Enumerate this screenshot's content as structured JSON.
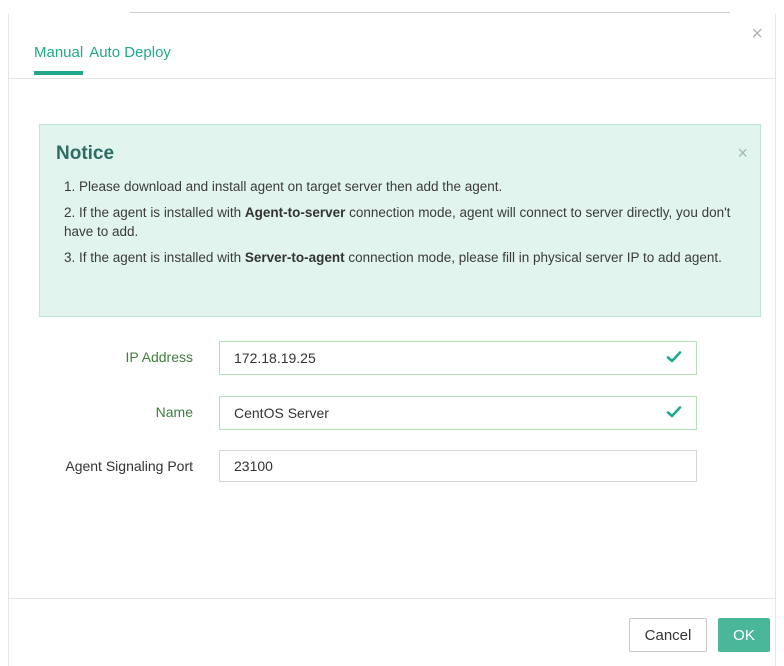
{
  "dialog": {
    "close_icon": "close-icon"
  },
  "tabs": [
    {
      "label": "Manual",
      "active": true
    },
    {
      "label": "Auto Deploy",
      "active": false
    }
  ],
  "notice": {
    "title": "Notice",
    "close_icon": "close-icon",
    "items": [
      {
        "parts": [
          "1. Please download and install agent on target server then add the agent."
        ]
      },
      {
        "pre": "2. If the agent is installed with ",
        "bold": "Agent-to-server",
        "post": " connection mode, agent will connect to server directly, you don't have to add."
      },
      {
        "pre": "3. If the agent is installed with ",
        "bold": "Server-to-agent",
        "post": " connection mode, please fill in physical server IP to add agent."
      }
    ]
  },
  "form": {
    "ip_address": {
      "label": "IP Address",
      "value": "172.18.19.25",
      "valid": true
    },
    "name": {
      "label": "Name",
      "value": "CentOS Server",
      "valid": true
    },
    "signaling_port": {
      "label": "Agent Signaling Port",
      "value": "23100"
    }
  },
  "buttons": {
    "cancel": "Cancel",
    "ok": "OK"
  },
  "colors": {
    "accent": "#22a88a",
    "ok_button": "#4ab79b",
    "notice_bg": "#e1f4ee",
    "valid_label": "#3f7d3f"
  }
}
